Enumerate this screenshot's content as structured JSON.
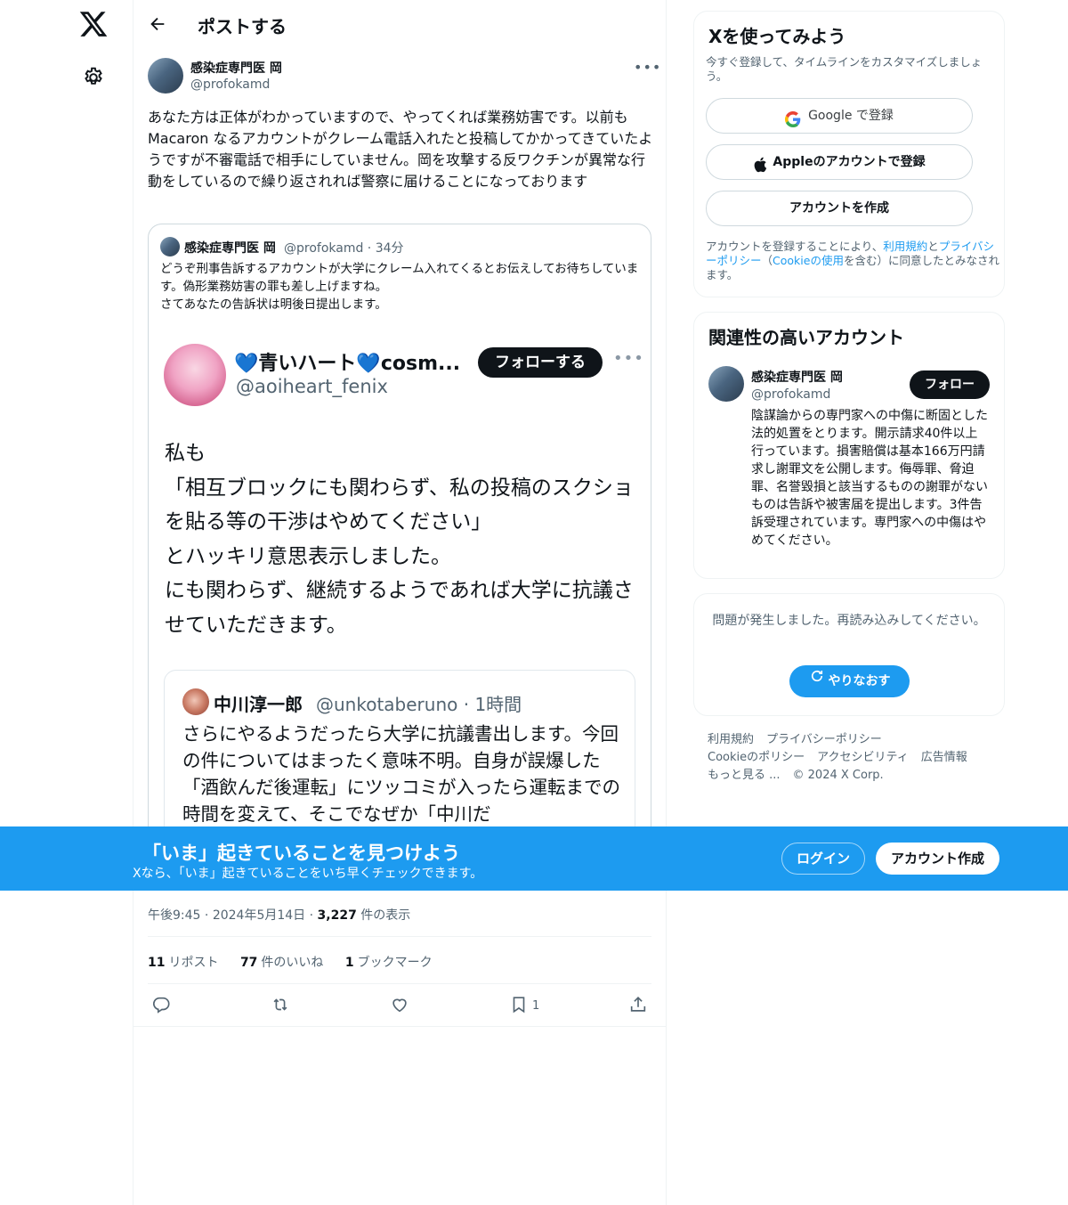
{
  "header": {
    "title": "ポストする"
  },
  "post": {
    "author_name": "感染症専門医 岡",
    "author_handle": "@profokamd",
    "text": "あなた方は正体がわかっていますので、やってくれば業務妨害です。以前もMacaron なるアカウントがクレーム電話入れたと投稿してかかってきていたようですが不審電話で相手にしていません。岡を攻撃する反ワクチンが異常な行動をしているので繰り返されれば警察に届けることになっております",
    "time": "午後9:45",
    "date": "2024年5月14日",
    "views_count": "3,227",
    "views_label": "件の表示",
    "reposts_count": "11",
    "reposts_label": "リポスト",
    "likes_count": "77",
    "likes_label": "件のいいね",
    "bookmarks_count": "1",
    "bookmarks_label": "ブックマーク",
    "bookmark_action_count": "1"
  },
  "quote": {
    "author_name": "感染症専門医 岡",
    "meta": "@profokamd · 34分",
    "text": "どうぞ刑事告訴するアカウントが大学にクレーム入れてくるとお伝えしてお待ちしています。偽形業務妨害の罪も差し上げますね。\nさてあなたの告訴状は明後日提出します。",
    "screenshot": {
      "name_prefix": "💙",
      "name": "青いハート",
      "name_suffix": "💙cosm...",
      "handle": "@aoiheart_fenix",
      "follow_label": "フォローする",
      "body": "私も\n「相互ブロックにも関わらず、私の投稿のスクショを貼る等の干渉はやめてください」\nとハッキリ意思表示しました。\nにも関わらず、継続するようであれば大学に抗議させていただきます。",
      "inner_name": "中川淳一郎",
      "inner_meta": "@unkotaberuno · 1時間",
      "inner_body": "さらにやるようだったら大学に抗議書出します。今回の件についてはまったく意味不明。自身が誤爆した「酒飲んだ後運転」にツッコミが入ったら運転までの時間を変えて、そこでなぜか「中川だ"
    }
  },
  "banner": {
    "title": "「いま」起きていることを見つけよう",
    "subtitle": "Xなら、「いま」起きていることをいち早くチェックできます。",
    "login_label": "ログイン",
    "signup_label": "アカウント作成"
  },
  "sidebar": {
    "signup_card": {
      "title": "Xを使ってみよう",
      "subtitle": "今すぐ登録して、タイムラインをカスタマイズしましょう。",
      "google_label": "Google で登録",
      "apple_label": "Appleのアカウントで登録",
      "create_label": "アカウントを作成",
      "legal_prefix": "アカウントを登録することにより、",
      "terms_link": "利用規約",
      "legal_and": "と",
      "privacy_link": "プライバシーポリシー",
      "legal_paren_open": "（",
      "cookie_link": "Cookieの使用",
      "legal_suffix": "を含む）に同意したとみなされます。"
    },
    "related_card": {
      "title": "関連性の高いアカウント",
      "name": "感染症専門医 岡",
      "handle": "@profokamd",
      "follow_label": "フォロー",
      "bio": "陰謀論からの専門家への中傷に断固とした法的処置をとります。開示請求40件以上行っています。損害賠償は基本166万円請求し謝罪文を公開します。侮辱罪、脅迫罪、名誉毀損と該当するものの謝罪がないものは告訴や被害届を提出します。3件告訴受理されています。専門家への中傷はやめてください。"
    },
    "error_card": {
      "message": "問題が発生しました。再読み込みしてください。",
      "retry_label": "やりなおす"
    },
    "footer": {
      "links": [
        "利用規約",
        "プライバシーポリシー",
        "Cookieのポリシー",
        "アクセシビリティ",
        "広告情報",
        "もっと見る ...",
        "© 2024 X Corp."
      ]
    }
  },
  "colors": {
    "accent": "#1d9bf0",
    "text": "#0f1419",
    "muted": "#536471",
    "border": "#eff3f4"
  },
  "icons": [
    "x-logo-icon",
    "gear-icon",
    "back-arrow-icon",
    "more-icon",
    "reply-icon",
    "repost-icon",
    "like-icon",
    "bookmark-icon",
    "share-icon",
    "google-icon",
    "apple-icon",
    "refresh-icon"
  ]
}
